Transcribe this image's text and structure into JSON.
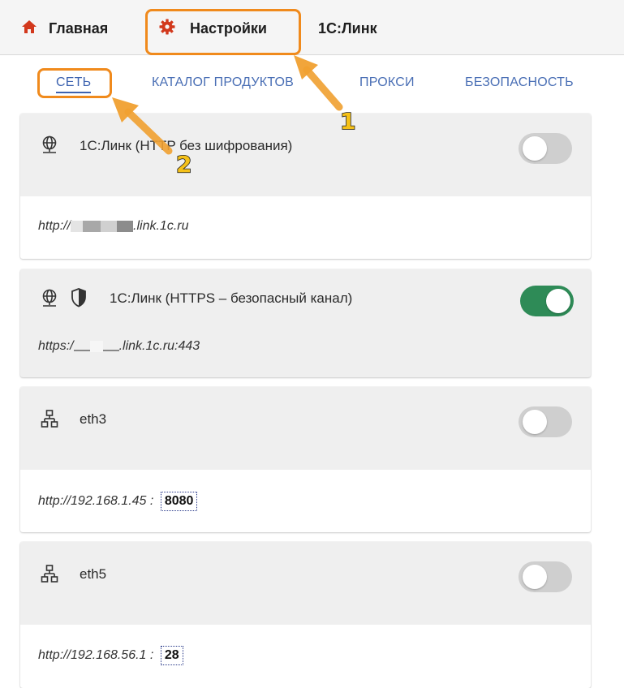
{
  "topnav": {
    "home": {
      "label": "Главная",
      "icon": "home-icon"
    },
    "settings": {
      "label": "Настройки",
      "icon": "gear-icon"
    },
    "link1c": {
      "label": "1С:Линк"
    }
  },
  "tabs": [
    "СЕТЬ",
    "КАТАЛОГ ПРОДУКТОВ",
    "ПРОКСИ",
    "БЕЗОПАСНОСТЬ"
  ],
  "cards": [
    {
      "title": "1С:Линк (HTTP без шифрования)",
      "url_prefix": "http://",
      "url_suffix": ".link.1c.ru",
      "enabled": false,
      "icons": [
        "globe-icon"
      ]
    },
    {
      "title": "1С:Линк (HTTPS – безопасный канал)",
      "url_prefix": "https:/",
      "url_suffix": ".link.1c.ru:443",
      "enabled": true,
      "icons": [
        "globe-icon",
        "shield-icon"
      ]
    },
    {
      "title": "eth3",
      "url": "http://192.168.1.45",
      "separator": ":",
      "port": "8080",
      "enabled": false,
      "icons": [
        "network-icon"
      ]
    },
    {
      "title": "eth5",
      "url": "http://192.168.56.1",
      "separator": ":",
      "port": "28",
      "enabled": false,
      "icons": [
        "network-icon"
      ]
    }
  ],
  "annotations": {
    "marker1": "1",
    "marker2": "2"
  },
  "colors": {
    "accent": "#f08a1c",
    "toggle_on": "#2e8b57",
    "tab_link": "#4a6fb5",
    "nav_icon": "#d2381c"
  }
}
